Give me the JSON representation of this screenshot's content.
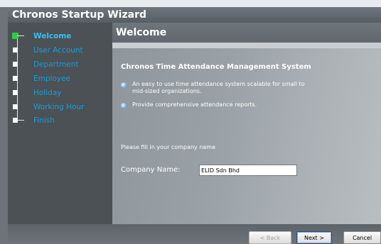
{
  "window": {
    "title": "Chronos Startup Wizard"
  },
  "wizard": {
    "steps": [
      {
        "label": "Welcome",
        "active": true
      },
      {
        "label": "User Account",
        "active": false
      },
      {
        "label": "Department",
        "active": false
      },
      {
        "label": "Employee",
        "active": false
      },
      {
        "label": "Holiday",
        "active": false
      },
      {
        "label": "Working Hour",
        "active": false
      },
      {
        "label": "Finish",
        "active": false
      }
    ]
  },
  "page": {
    "header": "Welcome",
    "system_title": "Chronos Time Attendance Management System",
    "bullets": [
      "An easy to use time attendance system scalable for small to mid-sized organizations.",
      "Provide comprehensive attendance reports."
    ],
    "instruction": "Please fill in your company name",
    "company_label": "Company Name:",
    "company_value": "ELID Sdn Bhd"
  },
  "buttons": {
    "back": "< Back",
    "next": "Next >",
    "cancel": "Cancel"
  },
  "colors": {
    "accent": "#1d9bd6",
    "active_step": "#2ecc40"
  }
}
